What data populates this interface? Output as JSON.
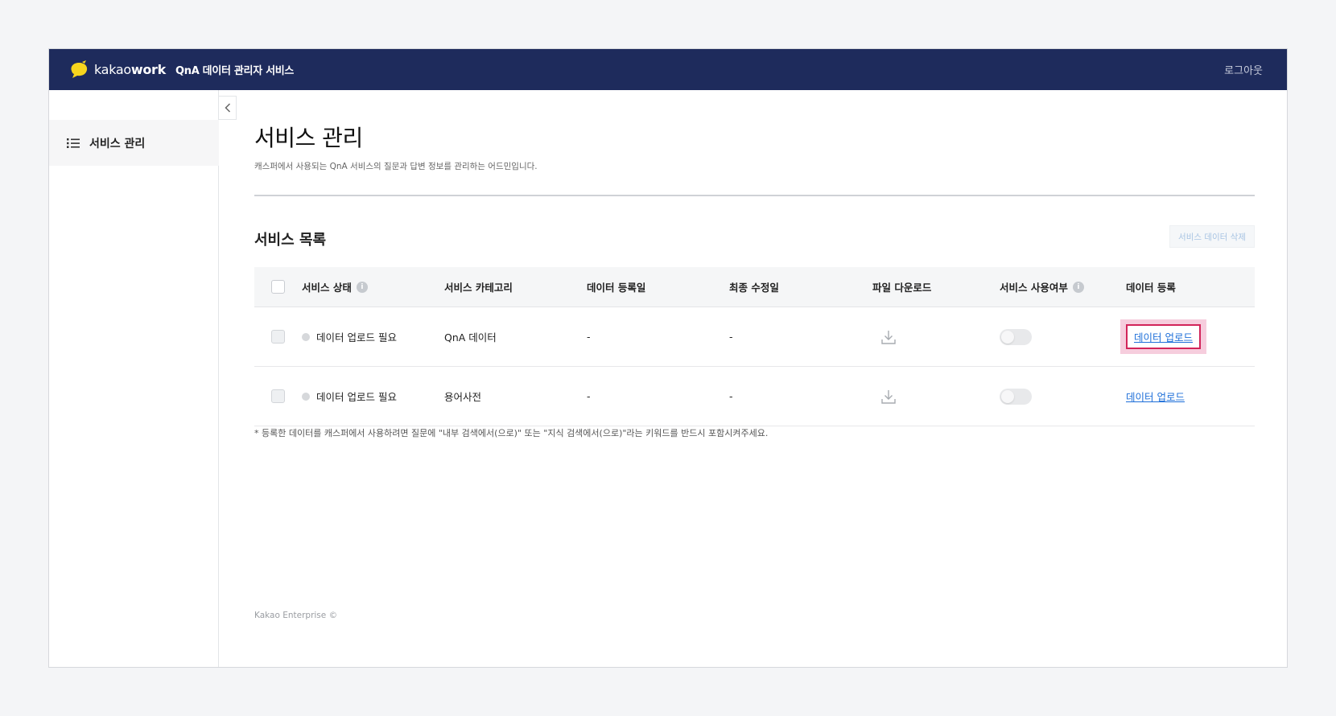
{
  "header": {
    "brand_prefix": "kakao",
    "brand_suffix": "work",
    "app_title": "QnA 데이터 관리자 서비스",
    "logout_label": "로그아웃"
  },
  "sidebar": {
    "items": [
      {
        "label": "서비스 관리",
        "icon": "list-icon",
        "active": true
      }
    ]
  },
  "page": {
    "title": "서비스 관리",
    "description": "캐스퍼에서 사용되는 QnA 서비스의 질문과 답변 정보를 관리하는 어드민입니다."
  },
  "section": {
    "title": "서비스 목록",
    "delete_button": "서비스 데이터 삭제"
  },
  "table": {
    "columns": [
      "서비스 상태",
      "서비스 카테고리",
      "데이터 등록일",
      "최종 수정일",
      "파일 다운로드",
      "서비스 사용여부",
      "데이터 등록"
    ],
    "info_icon_glyph": "i",
    "rows": [
      {
        "status": "데이터 업로드 필요",
        "category": "QnA 데이터",
        "registered": "-",
        "modified": "-",
        "enabled": false,
        "action": "데이터 업로드",
        "highlighted": true
      },
      {
        "status": "데이터 업로드 필요",
        "category": "용어사전",
        "registered": "-",
        "modified": "-",
        "enabled": false,
        "action": "데이터 업로드",
        "highlighted": false
      }
    ]
  },
  "footnote": "* 등록한 데이터를 캐스퍼에서 사용하려면 질문에 \"내부 검색에서(으로)\" 또는 \"지식 검색에서(으로)\"라는 키워드를 반드시 포함시켜주세요.",
  "copyright": "Kakao Enterprise ©",
  "colors": {
    "topbar": "#1e2b5c",
    "link": "#1e6fd9",
    "highlight_border": "#d2245a",
    "highlight_fill": "#f6cddd"
  }
}
